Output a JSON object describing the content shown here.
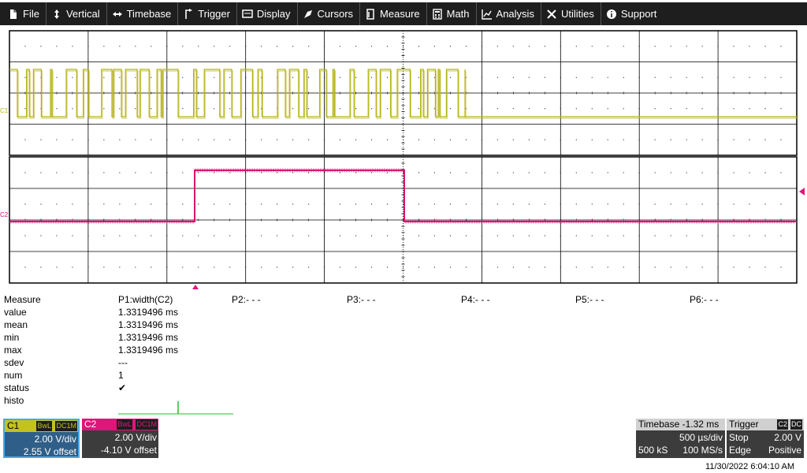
{
  "menu": {
    "items": [
      {
        "id": "file",
        "label": "File",
        "icon": "file-icon"
      },
      {
        "id": "vertical",
        "label": "Vertical",
        "icon": "vertical-arrows-icon"
      },
      {
        "id": "timebase",
        "label": "Timebase",
        "icon": "horizontal-arrows-icon"
      },
      {
        "id": "trigger",
        "label": "Trigger",
        "icon": "trigger-icon"
      },
      {
        "id": "display",
        "label": "Display",
        "icon": "display-icon"
      },
      {
        "id": "cursors",
        "label": "Cursors",
        "icon": "cursor-icon"
      },
      {
        "id": "measure",
        "label": "Measure",
        "icon": "measure-icon"
      },
      {
        "id": "math",
        "label": "Math",
        "icon": "calculator-icon"
      },
      {
        "id": "analysis",
        "label": "Analysis",
        "icon": "chart-icon"
      },
      {
        "id": "utilities",
        "label": "Utilities",
        "icon": "tools-icon"
      },
      {
        "id": "support",
        "label": "Support",
        "icon": "info-icon"
      }
    ]
  },
  "grids": {
    "c1_label": "C1",
    "c2_label": "C2",
    "c1_color": "#b5b319",
    "c2_color": "#d6166e",
    "grid_color": "#000000"
  },
  "measure": {
    "header": "Measure",
    "params": [
      "P1:width(C2)",
      "P2:- - -",
      "P3:- - -",
      "P4:- - -",
      "P5:- - -",
      "P6:- - -"
    ],
    "rows": [
      {
        "label": "value",
        "p1": "1.3319496 ms"
      },
      {
        "label": "mean",
        "p1": "1.3319496 ms"
      },
      {
        "label": "min",
        "p1": "1.3319496 ms"
      },
      {
        "label": "max",
        "p1": "1.3319496 ms"
      },
      {
        "label": "sdev",
        "p1": "---"
      },
      {
        "label": "num",
        "p1": "1"
      },
      {
        "label": "status",
        "p1": "✔"
      },
      {
        "label": "histo",
        "p1": ""
      }
    ],
    "histo_color": "#22c422"
  },
  "channels": {
    "c1": {
      "name": "C1",
      "bwl": "BwL",
      "coupling": "DC1M",
      "vdiv": "2.00 V/div",
      "offset": "2.55 V offset"
    },
    "c2": {
      "name": "C2",
      "bwl": "BwL",
      "coupling": "DC1M",
      "vdiv": "2.00 V/div",
      "offset": "-4.10 V offset"
    }
  },
  "timebase": {
    "header": "Timebase -1.32 ms",
    "tdiv": "500 µs/div",
    "samples": "500 kS",
    "rate": "100 MS/s"
  },
  "trigger": {
    "header": "Trigger",
    "source": "C2",
    "coupling": "DC",
    "mode": "Stop",
    "level": "2.00 V",
    "type": "Edge",
    "slope": "Positive"
  },
  "timestamp": "11/30/2022 6:04:10 AM"
}
